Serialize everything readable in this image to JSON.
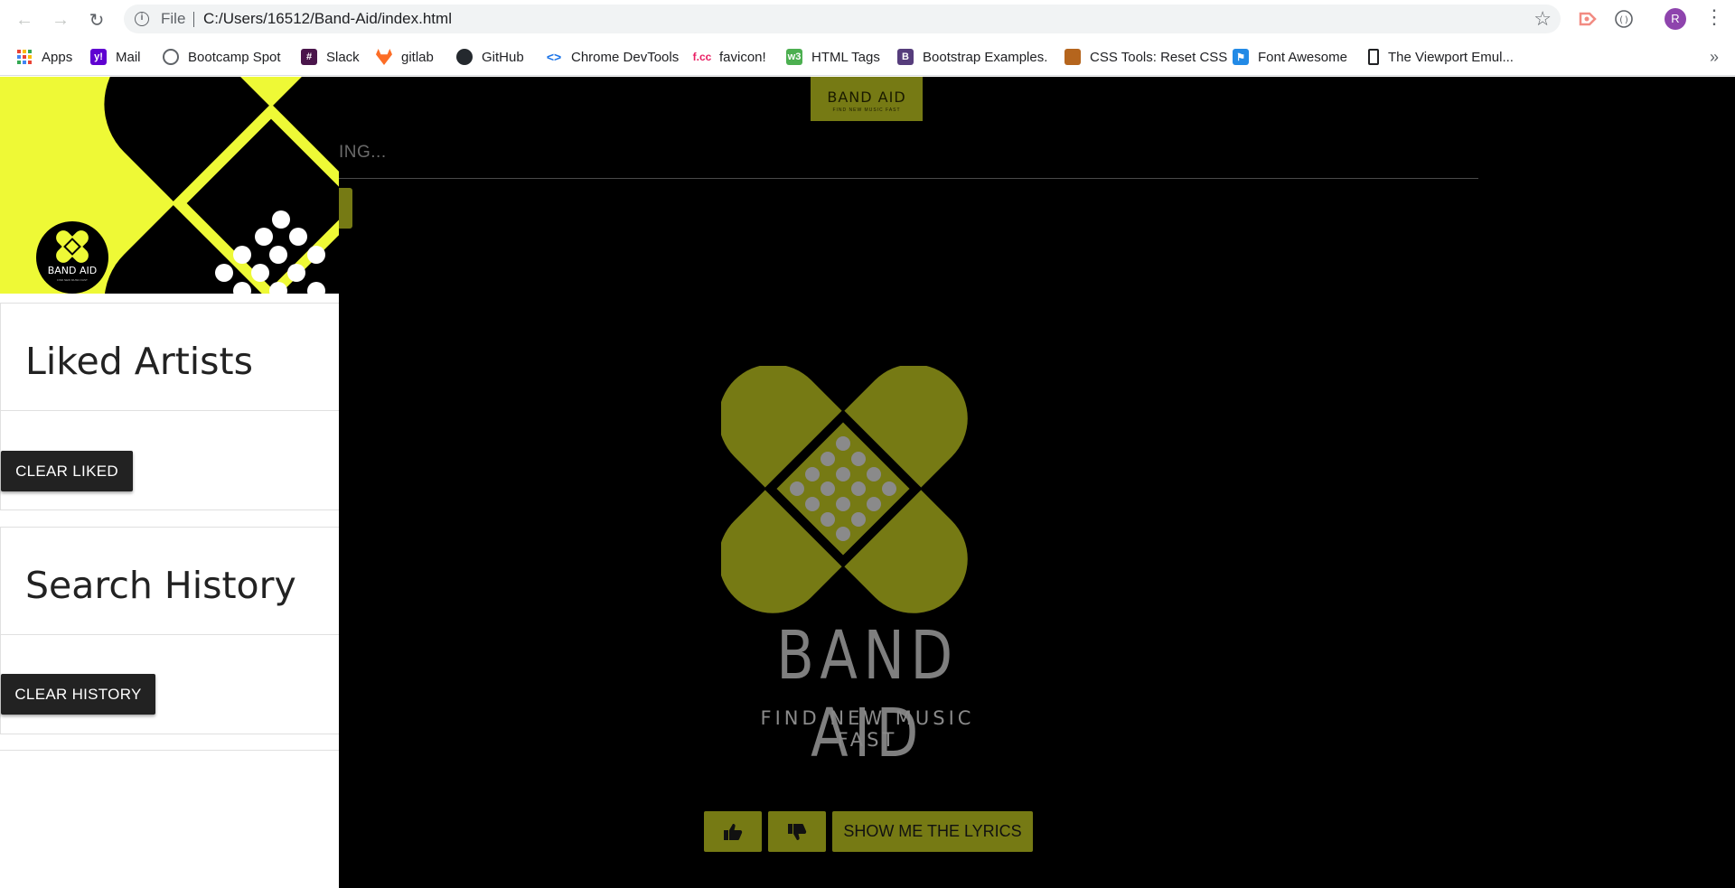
{
  "browser": {
    "scheme": "File",
    "url": "C:/Users/16512/Band-Aid/index.html",
    "profile_initial": "R",
    "bookmarks": [
      {
        "label": "Apps",
        "icon": "apps-grid-icon",
        "color": "#ea4335"
      },
      {
        "label": "Mail",
        "icon": "yahoo-icon",
        "color": "#5f01d1"
      },
      {
        "label": "Bootcamp Spot",
        "icon": "globe-icon",
        "color": "#5f6368"
      },
      {
        "label": "Slack",
        "icon": "slack-icon",
        "color": "#4a154b"
      },
      {
        "label": "gitlab",
        "icon": "gitlab-icon",
        "color": "#fc6d26"
      },
      {
        "label": "GitHub",
        "icon": "github-icon",
        "color": "#24292e"
      },
      {
        "label": "Chrome DevTools",
        "icon": "devtools-icon",
        "color": "#1a73e8"
      },
      {
        "label": "favicon!",
        "icon": "favicon-cc-icon",
        "color": "#e91e63"
      },
      {
        "label": "HTML Tags",
        "icon": "w3-icon",
        "color": "#4caf50"
      },
      {
        "label": "Bootstrap Examples.",
        "icon": "bootstrap-icon",
        "color": "#563d7c"
      },
      {
        "label": "CSS Tools: Reset CSS",
        "icon": "reset-css-icon",
        "color": "#b5651d"
      },
      {
        "label": "Font Awesome",
        "icon": "font-awesome-flag-icon",
        "color": "#228ae6"
      },
      {
        "label": "The Viewport Emul...",
        "icon": "device-icon",
        "color": "#202124"
      }
    ]
  },
  "main": {
    "top_logo": {
      "name": "BAND AID",
      "tagline": "FIND NEW MUSIC FAST"
    },
    "search_placeholder": "ING...",
    "brand_name": "BAND AID",
    "brand_tagline": "FIND NEW MUSIC FAST",
    "lyrics_button": "SHOW ME THE LYRICS",
    "accent_color": "#767a14"
  },
  "sidebar": {
    "hero_logo": {
      "name": "BAND AID",
      "tagline": "FIND NEW MUSIC FAST"
    },
    "liked": {
      "title": "Liked Artists",
      "clear_button": "CLEAR LIKED"
    },
    "history": {
      "title": "Search History",
      "clear_button": "CLEAR HISTORY"
    },
    "hero_color": "#eef936"
  }
}
